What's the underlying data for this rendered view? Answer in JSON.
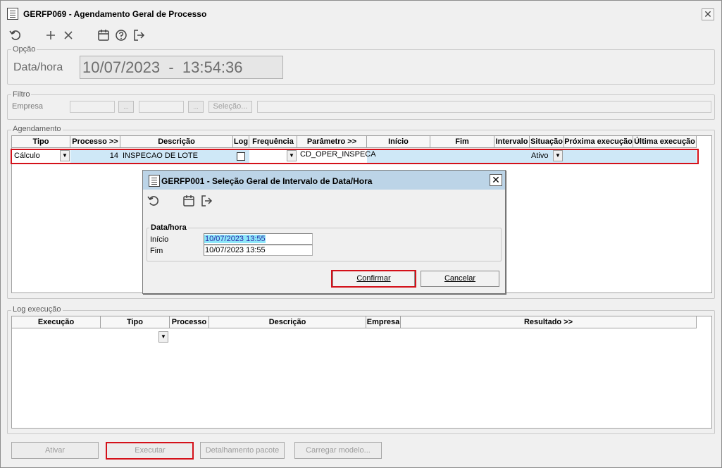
{
  "window": {
    "title": "GERFP069 - Agendamento Geral de Processo",
    "close_glyph": "✕"
  },
  "toolbar": {
    "icons": [
      "refresh-icon",
      "add-icon",
      "delete-icon",
      "calendar-icon",
      "help-icon",
      "exit-icon"
    ]
  },
  "opcao": {
    "group_label": "Opção",
    "field_label": "Data/hora",
    "value": "10/07/2023  -  13:54:36"
  },
  "filtro": {
    "group_label": "Filtro",
    "empresa_label": "Empresa",
    "empresa_from": "",
    "empresa_to": "",
    "lookup_glyph": "...",
    "selecao_label": "Seleção...",
    "selecao_value": ""
  },
  "agendamento": {
    "group_label": "Agendamento",
    "columns": [
      "Tipo",
      "Processo >>",
      "Descrição",
      "Log",
      "Frequência",
      "Parâmetro >>",
      "Início",
      "Fim",
      "Intervalo",
      "Situação",
      "Próxima execução",
      "Última execução"
    ],
    "row": {
      "tipo": "Cálculo",
      "processo": "14",
      "descricao": "INSPECAO DE LOTE",
      "log_checked": false,
      "frequencia": "",
      "parametro": "CD_OPER_INSPECA",
      "inicio": "",
      "fim": "",
      "intervalo": "",
      "situacao": "Ativo",
      "proxima": "",
      "ultima": ""
    }
  },
  "log_execucao": {
    "group_label": "Log execução",
    "columns": [
      "Execução",
      "Tipo",
      "Processo",
      "Descrição",
      "Empresa",
      "Resultado >>"
    ]
  },
  "bottom_buttons": {
    "ativar": "Ativar",
    "executar": "Executar",
    "detalhamento": "Detalhamento pacote",
    "carregar": "Carregar modelo..."
  },
  "dialog": {
    "title": "GERFP001 - Seleção Geral de Intervalo de Data/Hora",
    "close_glyph": "✕",
    "group_label": "Data/hora",
    "inicio_label": "Início",
    "inicio_value": "10/07/2023 13:55",
    "fim_label": "Fim",
    "fim_value": "10/07/2023 13:55",
    "confirmar": "Confirmar",
    "cancelar": "Cancelar"
  },
  "colors": {
    "selection": "#cfe8f7",
    "dialog_title": "#bcd4e7",
    "highlight_red": "#d4111a",
    "input_selected": "#8ee7f9"
  }
}
